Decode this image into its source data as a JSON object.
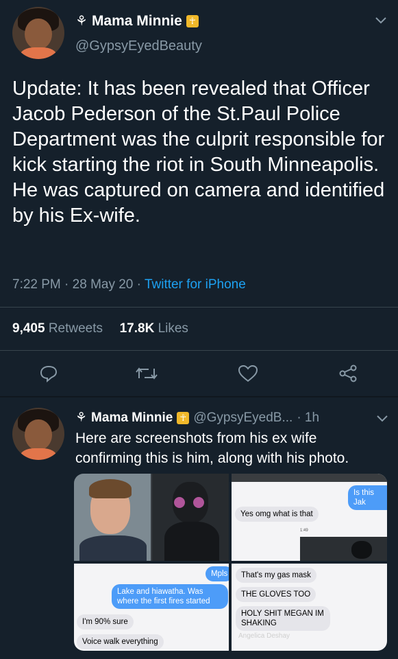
{
  "main_tweet": {
    "display_name": "Mama Minnie",
    "badge": "☥",
    "handle": "@GypsyEyedBeauty",
    "text": "Update: It has been revealed that Officer Jacob Pederson of the St.Paul Police Department was the culprit responsible for kick starting the riot in South Minneapolis. He was captured on camera and identified by his Ex-wife.",
    "time": "7:22 PM",
    "date": "28 May 20",
    "source": "Twitter for iPhone",
    "retweets_count": "9,405",
    "retweets_label": "Retweets",
    "likes_count": "17.8K",
    "likes_label": "Likes"
  },
  "reply": {
    "display_name": "Mama Minnie",
    "badge": "☥",
    "handle": "@GypsyEyedB...",
    "time": "· 1h",
    "text": "Here are screenshots from his ex wife confirming this is him, along with his photo."
  },
  "media": {
    "cell2": {
      "blue": "Is this Jak",
      "grey": "Yes omg what is that",
      "status": "1:49"
    },
    "cell3": {
      "blue_top": "Mpls",
      "blue": "Lake and hiawatha. Was where the first fires started",
      "grey1": "I'm 90% sure",
      "grey2": "Voice walk everything"
    },
    "cell4": {
      "grey1": "That's my gas mask",
      "grey2": "THE GLOVES TOO",
      "grey3": "HOLY SHIT MEGAN IM SHAKING",
      "watermark": "Angelica Deshay"
    }
  }
}
